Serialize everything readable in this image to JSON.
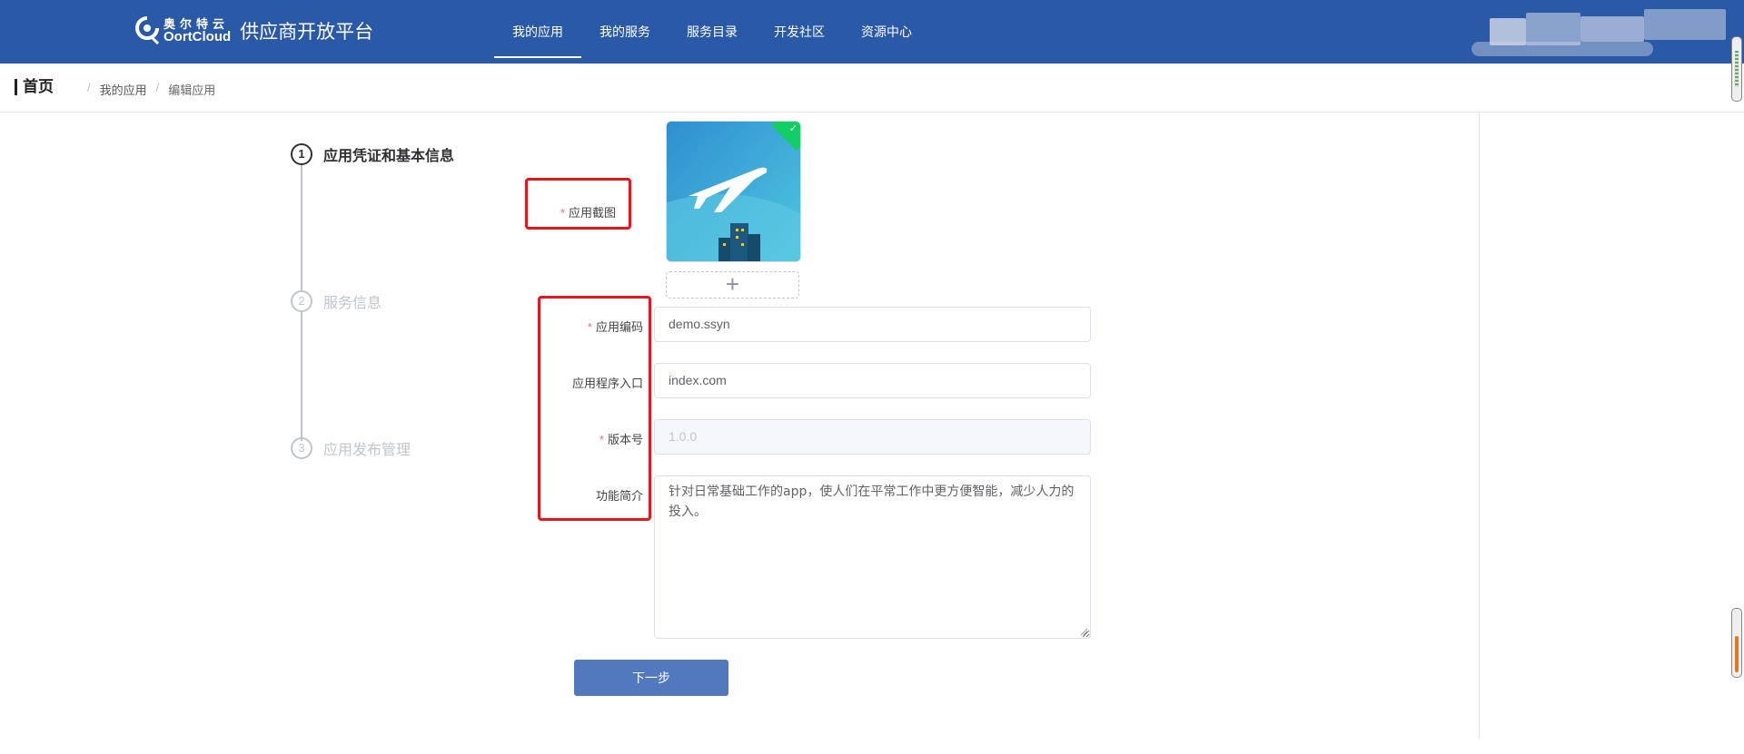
{
  "header": {
    "logo_cn": "奥尔特云",
    "logo_en": "OortCloud",
    "platform_title": "供应商开放平台",
    "nav": [
      {
        "label": "我的应用",
        "active": true
      },
      {
        "label": "我的服务",
        "active": false
      },
      {
        "label": "服务目录",
        "active": false
      },
      {
        "label": "开发社区",
        "active": false
      },
      {
        "label": "资源中心",
        "active": false
      }
    ],
    "brand_color": "#2a59a7"
  },
  "breadcrumb": {
    "home": "首页",
    "items": [
      "我的应用",
      "编辑应用"
    ],
    "separator": "/"
  },
  "steps": [
    {
      "number": "1",
      "label": "应用凭证和基本信息",
      "active": true
    },
    {
      "number": "2",
      "label": "服务信息",
      "active": false
    },
    {
      "number": "3",
      "label": "应用发布管理",
      "active": false
    }
  ],
  "form": {
    "screenshot_label": "应用截图",
    "screenshot_icon": "airplane-app-icon",
    "add_icon": "plus-icon",
    "app_code_label": "应用编码",
    "app_code_value": "demo.ssyn",
    "entry_label": "应用程序入口",
    "entry_value": "index.com",
    "version_label": "版本号",
    "version_value": "1.0.0",
    "intro_label": "功能简介",
    "intro_value": "针对日常基础工作的app，使人们在平常工作中更方便智能，减少人力的投入。",
    "required_mark": "*",
    "next_button": "下一步"
  },
  "colors": {
    "highlight_box": "#e8161a",
    "button": "#5279bd",
    "required": "#f56c6c"
  }
}
